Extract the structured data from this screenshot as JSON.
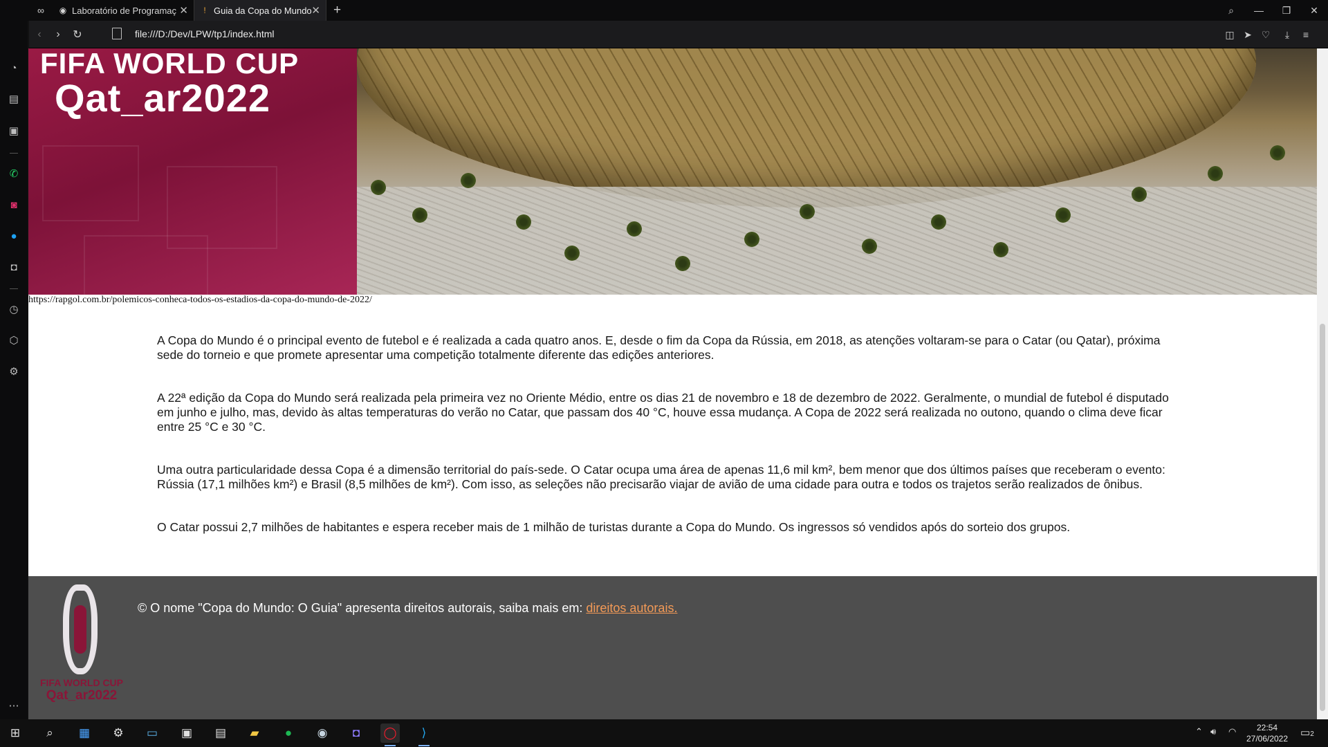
{
  "browser": {
    "tabs": [
      {
        "title": "Laboratório de Programaç",
        "active": false
      },
      {
        "title": "Guia da Copa do Mundo",
        "active": true
      }
    ],
    "new_tab": "+",
    "url": "file:///D:/Dev/LPW/tp1/index.html"
  },
  "hero": {
    "logo_line1": "FIFA WORLD CUP",
    "logo_line2": "Qat_ar2022"
  },
  "source_link": "https://rapgol.com.br/polemicos-conheca-todos-os-estadios-da-copa-do-mundo-de-2022/",
  "paragraphs": [
    "A Copa do Mundo é o principal evento de futebol e é realizada a cada quatro anos. E, desde o fim da Copa da Rússia, em 2018, as atenções voltaram-se para o Catar (ou Qatar), próxima sede do torneio e que promete apresentar uma competição totalmente diferente das edições anteriores.",
    "A 22ª edição da Copa do Mundo será realizada pela primeira vez no Oriente Médio, entre os dias 21 de novembro e 18 de dezembro de 2022. Geralmente, o mundial de futebol é disputado em junho e julho, mas, devido às altas temperaturas do verão no Catar, que passam dos 40 °C, houve essa mudança. A Copa de 2022 será realizada no outono, quando o clima deve ficar entre 25 °C e 30 °C.",
    "Uma outra particularidade dessa Copa é a dimensão territorial do país-sede. O Catar ocupa uma área de apenas 11,6 mil km², bem menor que dos últimos países que receberam o evento: Rússia (17,1 milhões km²) e Brasil (8,5 milhões de km²). Com isso, as seleções não precisarão viajar de avião de uma cidade para outra e todos os trajetos serão realizados de ônibus.",
    "O Catar possui 2,7 milhões de habitantes e espera receber mais de 1 milhão de turistas durante a Copa do Mundo. Os ingressos só vendidos após do sorteio dos grupos."
  ],
  "footer": {
    "text": "© O nome \"Copa do Mundo: O Guia\" apresenta direitos autorais, saiba mais em:",
    "link": "direitos autorais.",
    "logo_line1": "FIFA WORLD CUP",
    "logo_line2": "Qat_ar2022"
  },
  "taskbar": {
    "time": "22:54",
    "date": "27/06/2022",
    "notifications": "2"
  },
  "colors": {
    "accent_link": "#f39a57",
    "footer_bg": "#4e4e4e",
    "qatar_maroon": "#8a1538"
  }
}
